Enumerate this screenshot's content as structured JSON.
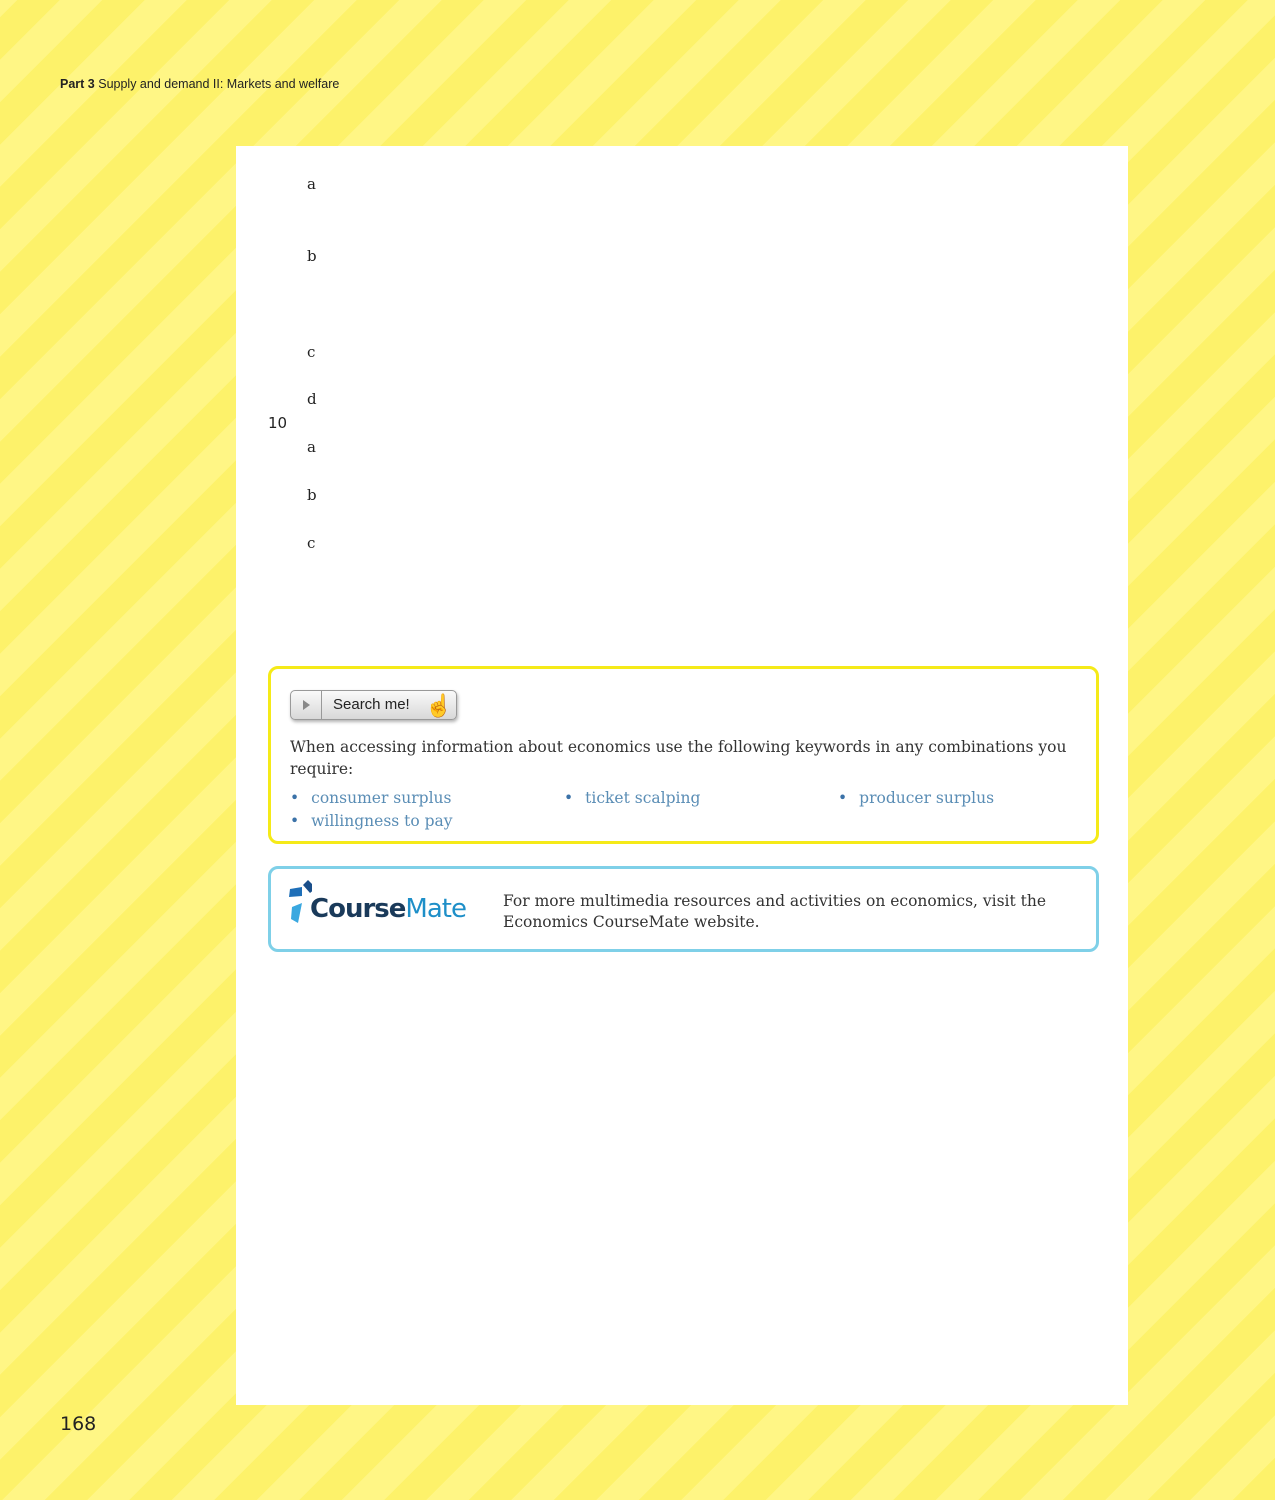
{
  "header": {
    "part": "Part 3",
    "title": "Supply and demand II: Markets and welfare"
  },
  "questions": {
    "q9_labels": [
      "a",
      "b",
      "c",
      "d"
    ],
    "q10_number": "10",
    "q10_labels": [
      "a",
      "b",
      "c"
    ]
  },
  "search": {
    "button_label": "Search me!",
    "intro": "When accessing information about economics use the following keywords in any combinations you require:",
    "keywords": [
      "consumer surplus",
      "ticket scalping",
      "producer surplus",
      "willingness to pay"
    ]
  },
  "coursemate": {
    "logo_text": "CourseMate",
    "text": "For more multimedia resources and activities on economics, visit the Economics CourseMate website."
  },
  "page_number": "168",
  "colors": {
    "search_border": "#f5ea18",
    "coursemate_border": "#7fd0e8",
    "keyword": "#5a8db5"
  }
}
